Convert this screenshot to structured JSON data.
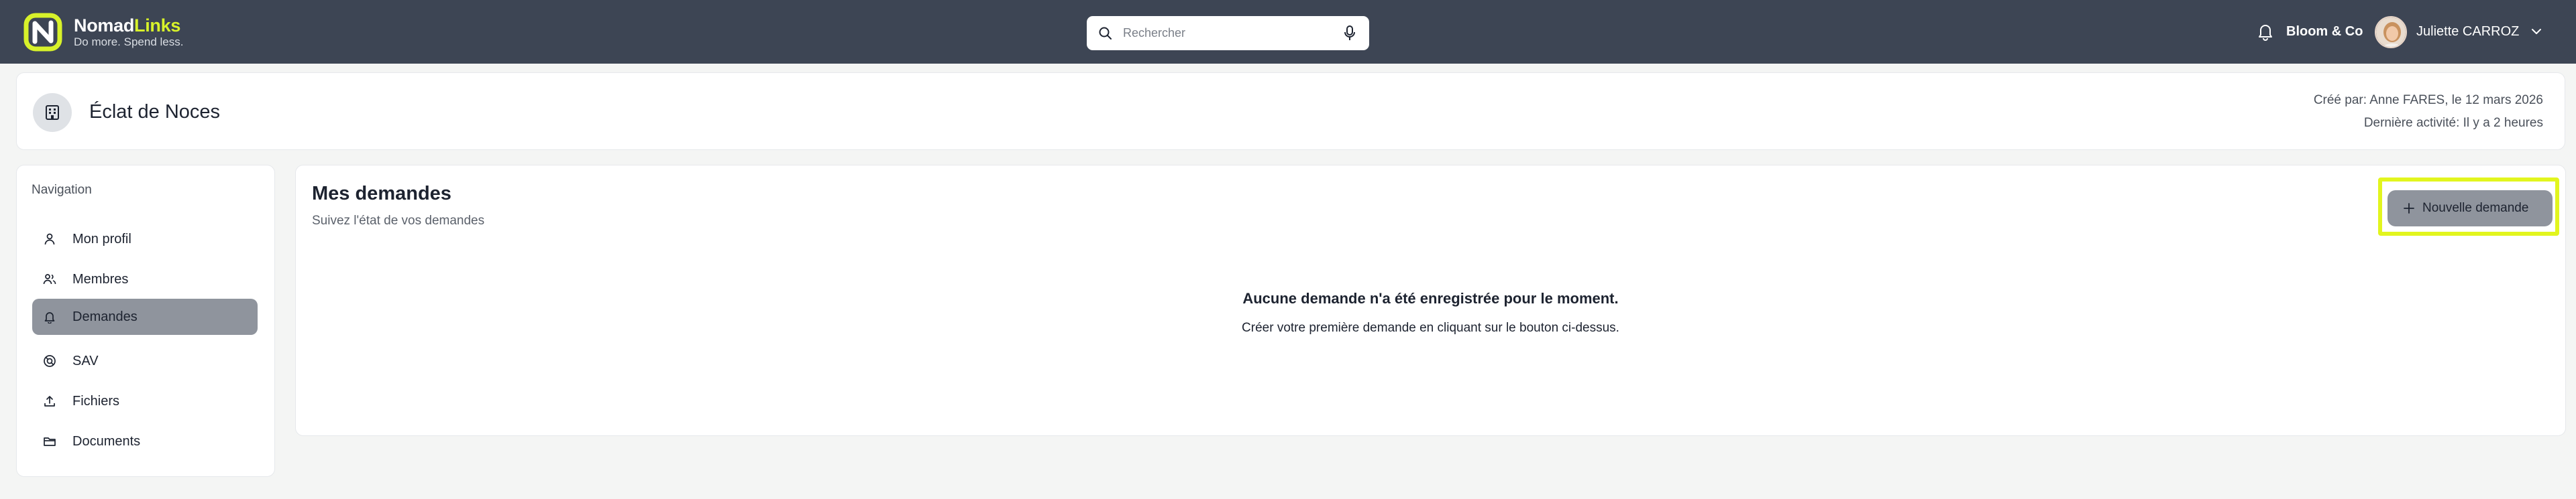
{
  "brand": {
    "name_part1": "Nomad",
    "name_part2": "Links",
    "tagline": "Do more. Spend less.",
    "accent_color": "#d8f22a"
  },
  "search": {
    "placeholder": "Rechercher",
    "value": ""
  },
  "header_right": {
    "company": "Bloom & Co",
    "user_name": "Juliette CARROZ"
  },
  "organization": {
    "title": "Éclat de Noces",
    "created_by": "Créé par: Anne FARES, le 12 mars 2026",
    "last_activity": "Dernière activité: Il y a 2 heures"
  },
  "sidebar": {
    "title": "Navigation",
    "items": [
      {
        "label": "Mon profil",
        "icon": "user-icon",
        "active": false
      },
      {
        "label": "Membres",
        "icon": "users-icon",
        "active": false
      },
      {
        "label": "Demandes",
        "icon": "bell-icon",
        "active": true
      },
      {
        "label": "SAV",
        "icon": "support-icon",
        "active": false
      },
      {
        "label": "Fichiers",
        "icon": "upload-icon",
        "active": false
      },
      {
        "label": "Documents",
        "icon": "folder-icon",
        "active": false
      }
    ]
  },
  "main": {
    "title": "Mes demandes",
    "subtitle": "Suivez l'état de vos demandes",
    "new_button_label": "Nouvelle demande",
    "empty_title": "Aucune demande n'a été enregistrée pour le moment.",
    "empty_text": "Créer votre première demande en cliquant sur le bouton ci-dessus."
  },
  "colors": {
    "topbar": "#3d4554",
    "active_nav": "#8f949d",
    "highlight": "#e2f51e"
  }
}
